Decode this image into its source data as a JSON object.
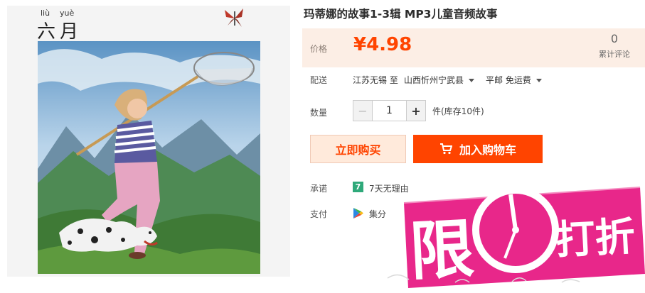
{
  "cover": {
    "pinyin_1": "liù",
    "pinyin_2": "yuè",
    "month": "六月"
  },
  "product": {
    "title": "玛蒂娜的故事1-3辑 MP3儿童音频故事",
    "price_label": "价格",
    "price": "¥4.98",
    "review_count": "0",
    "review_label": "累计评论"
  },
  "delivery": {
    "label": "配送",
    "from": "江苏无锡 至",
    "to": "山西忻州宁武县",
    "shipping": "平邮 免运费"
  },
  "quantity": {
    "label": "数量",
    "value": "1",
    "stock": "件(库存10件)"
  },
  "actions": {
    "buy_now": "立即购买",
    "add_to_cart": "加入购物车"
  },
  "promise": {
    "label": "承诺",
    "icon_text": "7",
    "text": "7天无理由"
  },
  "payment": {
    "label": "支付",
    "text": "集分"
  },
  "badge": {
    "char_1": "限",
    "char_3": "打折"
  },
  "colors": {
    "accent": "#ff4400",
    "price_bg": "#fceee5",
    "badge_pink": "#e8278a",
    "promise_green": "#2fa97a"
  }
}
